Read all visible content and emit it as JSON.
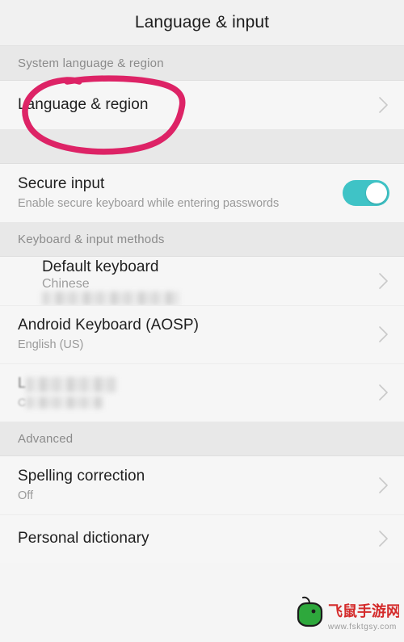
{
  "header": {
    "title": "Language & input"
  },
  "sections": [
    {
      "id": "system-language-region",
      "label": "System language & region",
      "rows": [
        {
          "id": "language-and-region",
          "title": "Language & region",
          "subtitle": "",
          "value": "",
          "accessory": "chevron-right-icon",
          "annotated": true
        }
      ]
    },
    {
      "id": "secure-input-section",
      "label": "",
      "rows": [
        {
          "id": "secure-input",
          "title": "Secure input",
          "subtitle": "Enable secure keyboard while entering passwords",
          "value": "",
          "accessory": "toggle-switch",
          "toggle_on": true
        }
      ]
    },
    {
      "id": "keyboard-input-methods",
      "label": "Keyboard & input methods",
      "rows": [
        {
          "id": "default-keyboard",
          "title": "Default keyboard",
          "subtitle": "",
          "value": "Chinese",
          "value_redacted": true,
          "accessory": "chevron-right-icon"
        },
        {
          "id": "android-keyboard-aosp",
          "title": "Android Keyboard (AOSP)",
          "subtitle": "English (US)",
          "value": "",
          "accessory": "chevron-right-icon"
        },
        {
          "id": "redacted-input-method",
          "title": "L",
          "subtitle": "C",
          "title_redacted": true,
          "subtitle_redacted": true,
          "value": "",
          "accessory": "chevron-right-icon"
        }
      ]
    },
    {
      "id": "advanced",
      "label": "Advanced",
      "rows": [
        {
          "id": "spelling-correction",
          "title": "Spelling correction",
          "subtitle": "Off",
          "value": "",
          "accessory": "chevron-right-icon"
        },
        {
          "id": "personal-dictionary",
          "title": "Personal dictionary",
          "subtitle": "",
          "value": "",
          "accessory": "chevron-right-icon"
        }
      ]
    }
  ],
  "annotation": {
    "kind": "hand-drawn-ellipse",
    "color": "#dd2366",
    "target": "Language & region"
  },
  "watermark": {
    "brand": "飞鼠手游网",
    "url": "www.fsktgsy.com",
    "icon": "mouse-icon",
    "brand_color": "#d42b2b",
    "icon_color": "#2ea83c"
  },
  "colors": {
    "page_background": "#f5f5f5",
    "row_background": "#f6f6f6",
    "section_background": "#e8e8e8",
    "header_background": "#f1f1f1",
    "title_text": "#1f1f1f",
    "secondary_text": "#9a9a9a",
    "toggle_on": "#3fc3c6",
    "annotation": "#dd2366"
  }
}
